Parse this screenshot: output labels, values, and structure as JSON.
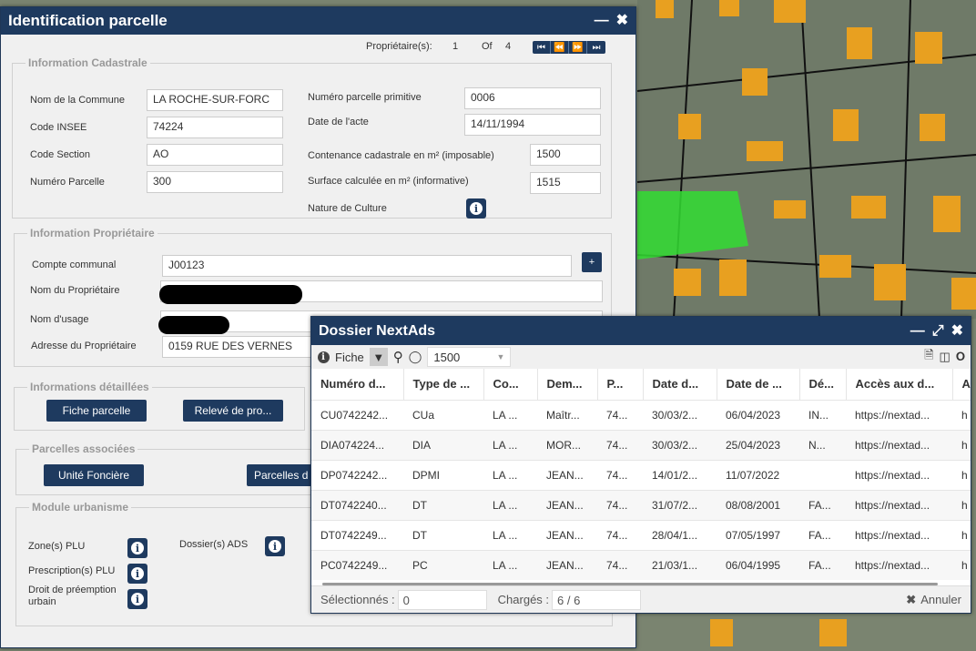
{
  "parcel_window": {
    "title": "Identification parcelle",
    "minimize_icon": "minus-icon",
    "close_icon": "close-icon",
    "owners_label": "Propriétaire(s):",
    "owners_current": "1",
    "owners_of": "Of",
    "owners_total": "4",
    "cadastral": {
      "legend": "Information Cadastrale",
      "commune_label": "Nom de la Commune",
      "commune_value": "LA ROCHE-SUR-FORC",
      "insee_label": "Code INSEE",
      "insee_value": "74224",
      "section_label": "Code Section",
      "section_value": "AO",
      "parcel_num_label": "Numéro Parcelle",
      "parcel_num_value": "300",
      "primitive_label": "Numéro parcelle primitive",
      "primitive_value": "0006",
      "act_date_label": "Date de l'acte",
      "act_date_value": "14/11/1994",
      "contenance_label": "Contenance cadastrale en m² (imposable)",
      "contenance_value": "1500",
      "surface_label": "Surface calculée en m² (informative)",
      "surface_value": "1515",
      "culture_label": "Nature de Culture"
    },
    "owner": {
      "legend": "Information Propriétaire",
      "compte_label": "Compte communal",
      "compte_value": "J00123",
      "plus_label": "+",
      "name_label": "Nom du Propriétaire",
      "usage_label": "Nom d'usage",
      "address_label": "Adresse du Propriétaire",
      "address_value": "0159 RUE DES VERNES"
    },
    "details": {
      "legend": "Informations détaillées",
      "fiche_button": "Fiche parcelle",
      "releve_button": "Relevé de pro..."
    },
    "associated": {
      "legend": "Parcelles associées",
      "unite_button": "Unité Foncière",
      "parcelles_button": "Parcelles d"
    },
    "urbanism": {
      "legend": "Module urbanisme",
      "zone_label": "Zone(s) PLU",
      "ads_label": "Dossier(s) ADS",
      "prescription_label": "Prescription(s) PLU",
      "droit_label": "Droit de préemption urbain"
    }
  },
  "nextads_window": {
    "title": "Dossier NextAds",
    "toolbar": {
      "fiche_label": "Fiche",
      "filter_value": "1500"
    },
    "columns": [
      "Numéro d...",
      "Type de ...",
      "Co...",
      "Dem...",
      "P...",
      "Date d...",
      "Date de ...",
      "Dé...",
      "Accès aux d...",
      "A"
    ],
    "rows": [
      [
        "CU0742242...",
        "CUa",
        "LA ...",
        "Maîtr...",
        "74...",
        "30/03/2...",
        "06/04/2023",
        "IN...",
        "https://nextad...",
        "h"
      ],
      [
        "DIA074224...",
        "DIA",
        "LA ...",
        "MOR...",
        "74...",
        "30/03/2...",
        "25/04/2023",
        "N...",
        "https://nextad...",
        "h"
      ],
      [
        "DP0742242...",
        "DPMI",
        "LA ...",
        "JEAN...",
        "74...",
        "14/01/2...",
        "11/07/2022",
        "",
        "https://nextad...",
        "h"
      ],
      [
        "DT0742240...",
        "DT",
        "LA ...",
        "JEAN...",
        "74...",
        "31/07/2...",
        "08/08/2001",
        "FA...",
        "https://nextad...",
        "h"
      ],
      [
        "DT0742249...",
        "DT",
        "LA ...",
        "JEAN...",
        "74...",
        "28/04/1...",
        "07/05/1997",
        "FA...",
        "https://nextad...",
        "h"
      ],
      [
        "PC0742249...",
        "PC",
        "LA ...",
        "JEAN...",
        "74...",
        "21/03/1...",
        "06/04/1995",
        "FA...",
        "https://nextad...",
        "h"
      ]
    ],
    "footer": {
      "selected_label": "Sélectionnés :",
      "selected_value": "0",
      "loaded_label": "Chargés :",
      "loaded_value": "6 / 6",
      "cancel_label": "Annuler"
    }
  },
  "colors": {
    "header_navy": "#1e3a5f",
    "parcel_highlight": "#33dd33",
    "roof_orange": "#e8a020"
  }
}
